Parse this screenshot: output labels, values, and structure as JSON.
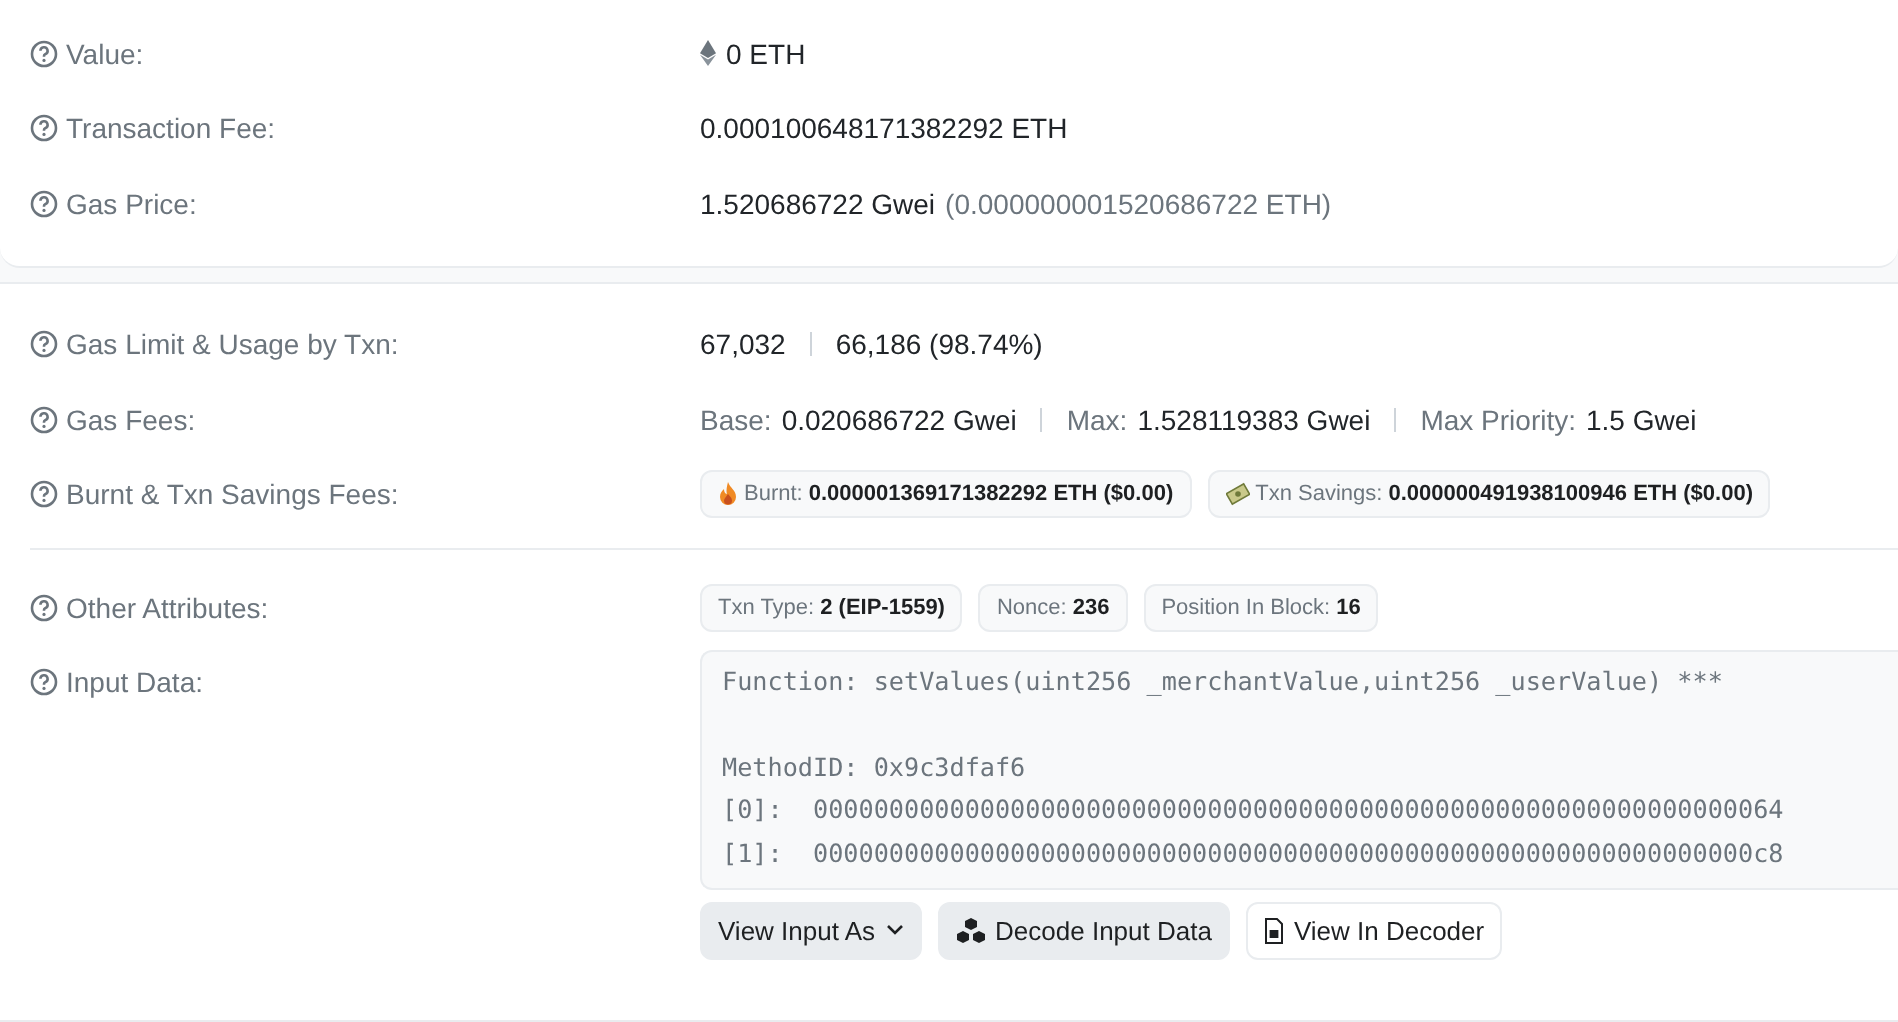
{
  "sections": [
    {
      "rows": [
        {
          "kind": "amount",
          "label": "Value:",
          "value": "0 ETH"
        },
        {
          "kind": "segments",
          "label": "Transaction Fee:",
          "segments": [
            {
              "value": "0.000100648171382292 ETH"
            }
          ]
        },
        {
          "kind": "segments",
          "label": "Gas Price:",
          "segments": [
            {
              "value": "1.520686722 Gwei",
              "note": "(0.000000001520686722 ETH)"
            }
          ]
        }
      ]
    },
    {
      "rows": [
        {
          "kind": "segments",
          "label": "Gas Limit & Usage by Txn:",
          "segments": [
            {
              "value": "67,032"
            },
            {
              "value": "66,186 (98.74%)"
            }
          ]
        },
        {
          "kind": "segments",
          "label": "Gas Fees:",
          "segments": [
            {
              "name": "Base:",
              "value": "0.020686722 Gwei"
            },
            {
              "name": "Max:",
              "value": "1.528119383 Gwei"
            },
            {
              "name": "Max Priority:",
              "value": "1.5 Gwei"
            }
          ]
        },
        {
          "kind": "badges",
          "label": "Burnt & Txn Savings Fees:",
          "badges": [
            {
              "kind": "burnt",
              "name": "Burnt:",
              "value": "0.000001369171382292 ETH ($0.00)"
            },
            {
              "kind": "savings",
              "name": "Txn Savings:",
              "value": "0.000000491938100946 ETH ($0.00)"
            }
          ]
        },
        {
          "kind": "divider"
        },
        {
          "kind": "badges",
          "label": "Other Attributes:",
          "badges": [
            {
              "kind": "plain",
              "name": "Txn Type:",
              "value": "2 (EIP-1559)"
            },
            {
              "kind": "plain",
              "name": "Nonce:",
              "value": "236"
            },
            {
              "kind": "plain",
              "name": "Position In Block:",
              "value": "16"
            }
          ]
        },
        {
          "kind": "input",
          "label": "Input Data:",
          "signature": "Function: setValues(uint256 _merchantValue,uint256 _userValue) ***",
          "lines": [
            "MethodID: 0x9c3dfaf6",
            "[0]:  0000000000000000000000000000000000000000000000000000000000000064",
            "[1]:  00000000000000000000000000000000000000000000000000000000000000c8"
          ],
          "buttons": [
            {
              "kind": "dropdown",
              "label": "View Input As"
            },
            {
              "kind": "decode",
              "label": "Decode Input Data"
            },
            {
              "kind": "decoder",
              "label": "View In Decoder"
            }
          ]
        }
      ]
    }
  ]
}
